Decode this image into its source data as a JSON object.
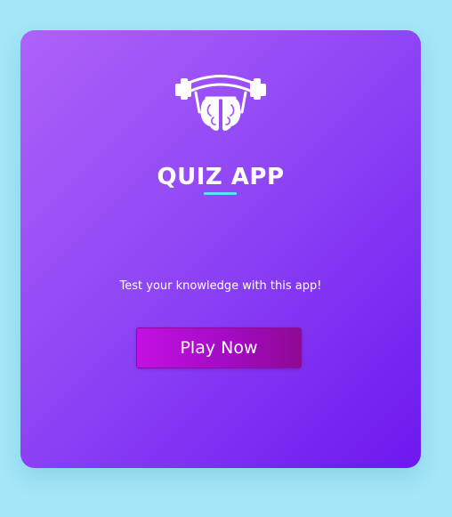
{
  "app": {
    "title": "QUIZ APP",
    "tagline": "Test your knowledge with this app!",
    "play_button_label": "Play Now",
    "logo_icon": "brain-dumbbell-icon"
  },
  "colors": {
    "page_background": "#a3e7f8",
    "card_gradient_start": "#ad62f8",
    "card_gradient_end": "#6d18ef",
    "title_underline": "#57e5f2",
    "button_gradient_start": "#c310e3",
    "button_gradient_end": "#8e0994",
    "text": "#ffffff"
  }
}
